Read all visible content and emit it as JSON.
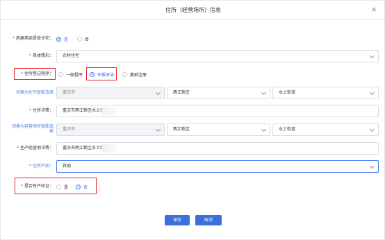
{
  "dialog": {
    "title": "住所（经营场所）信息",
    "close_glyph": "×"
  },
  "fields": {
    "use_as_residence": {
      "label": "房屋用途是否住宅：",
      "options": [
        "是",
        "否"
      ],
      "selected": "是"
    },
    "situation": {
      "label": "具体情形：",
      "value": "农村住宅"
    },
    "registration_procedure": {
      "label": "住所登记程序：",
      "options": [
        "一般程序",
        "申报承诺",
        "集群注册"
      ],
      "selected": "申报承诺"
    },
    "address_switch": {
      "label": "切换为住所智能选择",
      "city": "重庆市",
      "district": "两江新区",
      "street": "水土街道"
    },
    "address_detail": {
      "label": "住所详情：",
      "value": "重庆市两江新区水土街"
    },
    "business_switch": {
      "label_line1": "切换为经营场所智能选",
      "label_line2": "择",
      "city": "重庆市",
      "district": "两江新区",
      "street": "水土街道"
    },
    "business_detail": {
      "label": "生产经营地详情：",
      "value": "重庆市两江新区水土街"
    },
    "property_right": {
      "label": "住所产权：",
      "value": "其他"
    },
    "has_certificate": {
      "label": "是否有产权证：",
      "options": [
        "是",
        "否"
      ],
      "selected": "否"
    }
  },
  "buttons": {
    "save": "保存",
    "cancel": "取消"
  },
  "colors": {
    "accent": "#3f7bf0",
    "button": "#3b6fe0",
    "highlight": "#e2232a",
    "required_star": "#e53935"
  }
}
